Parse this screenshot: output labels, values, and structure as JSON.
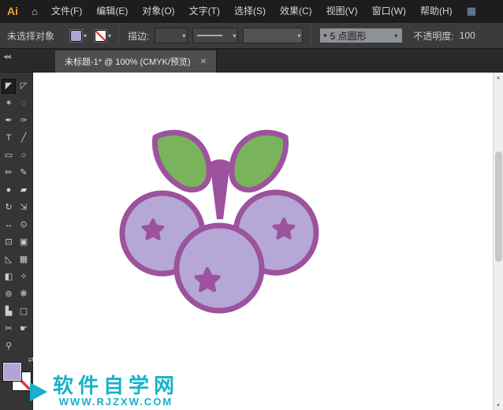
{
  "icons": {
    "home": "⌂",
    "workspace_switcher": "▦",
    "caret_down": "▾",
    "scroll_up": "▴",
    "scroll_down": "▾"
  },
  "menubar": {
    "logo": "Ai",
    "items": [
      "文件(F)",
      "编辑(E)",
      "对象(O)",
      "文字(T)",
      "选择(S)",
      "效果(C)",
      "视图(V)",
      "窗口(W)",
      "帮助(H)"
    ]
  },
  "controlbar": {
    "status": "未选择对象",
    "stroke_label": "描边:",
    "brush_bullet": "•",
    "brush_name": "5 点圆形",
    "opacity_label": "不透明度:",
    "opacity_value": "100",
    "fill_color": "#b3a4d6",
    "stroke_none_color": "#e03a3a"
  },
  "tabbar": {
    "collapse_icon": "◀◀",
    "tab_title": "未标题-1* @ 100% (CMYK/预览)",
    "close_icon": "✕"
  },
  "toolbar": {
    "swap_icon": "⇄",
    "tools": [
      {
        "name": "selection",
        "glyph": "◤",
        "selected": true
      },
      {
        "name": "direct-selection",
        "glyph": "◸"
      },
      {
        "name": "magic-wand",
        "glyph": "✶"
      },
      {
        "name": "lasso",
        "glyph": "◌"
      },
      {
        "name": "pen",
        "glyph": "✒"
      },
      {
        "name": "curvature",
        "glyph": "✑"
      },
      {
        "name": "type",
        "glyph": "T"
      },
      {
        "name": "line-segment",
        "glyph": "╱"
      },
      {
        "name": "rectangle",
        "glyph": "▭"
      },
      {
        "name": "ellipse",
        "glyph": "○"
      },
      {
        "name": "paintbrush",
        "glyph": "✏"
      },
      {
        "name": "pencil",
        "glyph": "✎"
      },
      {
        "name": "blob-brush",
        "glyph": "●"
      },
      {
        "name": "eraser",
        "glyph": "▰"
      },
      {
        "name": "rotate",
        "glyph": "↻"
      },
      {
        "name": "scale",
        "glyph": "⇲"
      },
      {
        "name": "width",
        "glyph": "↔"
      },
      {
        "name": "puppet-warp",
        "glyph": "⊙"
      },
      {
        "name": "free-transform",
        "glyph": "⊡"
      },
      {
        "name": "shape-builder",
        "glyph": "▣"
      },
      {
        "name": "perspective-grid",
        "glyph": "◺"
      },
      {
        "name": "mesh",
        "glyph": "▦"
      },
      {
        "name": "gradient",
        "glyph": "◧"
      },
      {
        "name": "eyedropper",
        "glyph": "✧"
      },
      {
        "name": "blend",
        "glyph": "⊚"
      },
      {
        "name": "symbol-sprayer",
        "glyph": "❋"
      },
      {
        "name": "column-graph",
        "glyph": "▙"
      },
      {
        "name": "artboard",
        "glyph": "▢"
      },
      {
        "name": "slice",
        "glyph": "✂"
      },
      {
        "name": "hand",
        "glyph": "☛"
      },
      {
        "name": "zoom",
        "glyph": "⚲"
      }
    ]
  },
  "swatches": {
    "fill_color": "#b3a4d6"
  },
  "artwork": {
    "leaf_fill": "#79b45c",
    "leaf_stroke": "#9d529d",
    "berry_fill": "#b5a8d6",
    "berry_stroke": "#9d529d",
    "star_color": "#9d529d"
  },
  "watermark": {
    "site_name": "软件自学网",
    "site_url": "WWW.RJZXW.COM",
    "color": "#17b2c8"
  }
}
